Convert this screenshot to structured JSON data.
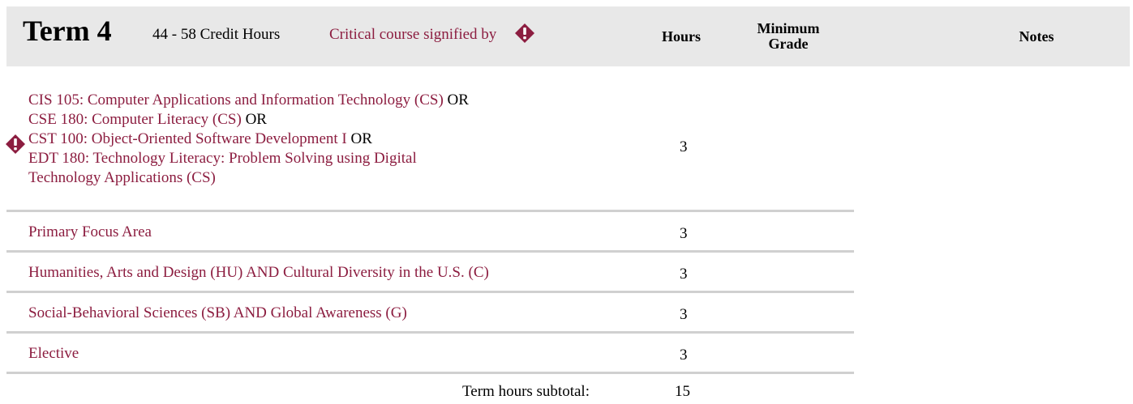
{
  "header": {
    "term_title": "Term 4",
    "credit_hours": "44 - 58 Credit Hours",
    "critical_text": "Critical course signified by",
    "col_hours": "Hours",
    "col_min_grade": "Minimum Grade",
    "col_notes": "Notes"
  },
  "rows": [
    {
      "critical": true,
      "courses": [
        {
          "label": "CIS 105: Computer Applications and Information Technology (CS)",
          "suffix": "OR"
        },
        {
          "label": "CSE 180: Computer Literacy (CS)",
          "suffix": "OR"
        },
        {
          "label": "CST 100: Object-Oriented Software Development I",
          "suffix": "OR"
        },
        {
          "label": "EDT 180: Technology Literacy: Problem Solving using Digital",
          "suffix": ""
        },
        {
          "label": "Technology Applications (CS)",
          "suffix": ""
        }
      ],
      "hours": "3"
    },
    {
      "label": "Primary Focus Area",
      "hours": "3"
    },
    {
      "label": "Humanities, Arts and Design (HU) AND Cultural Diversity in the U.S. (C)",
      "hours": "3"
    },
    {
      "label": "Social-Behavioral Sciences (SB) AND Global Awareness (G)",
      "hours": "3"
    },
    {
      "label": "Elective",
      "hours": "3"
    }
  ],
  "subtotal": {
    "label": "Term hours subtotal:",
    "value": "15"
  },
  "colors": {
    "accent": "#8c1d40",
    "header_bg": "#e8e8e8",
    "divider": "#d0d0d0"
  },
  "icons": {
    "critical": "critical-course-diamond-icon"
  }
}
